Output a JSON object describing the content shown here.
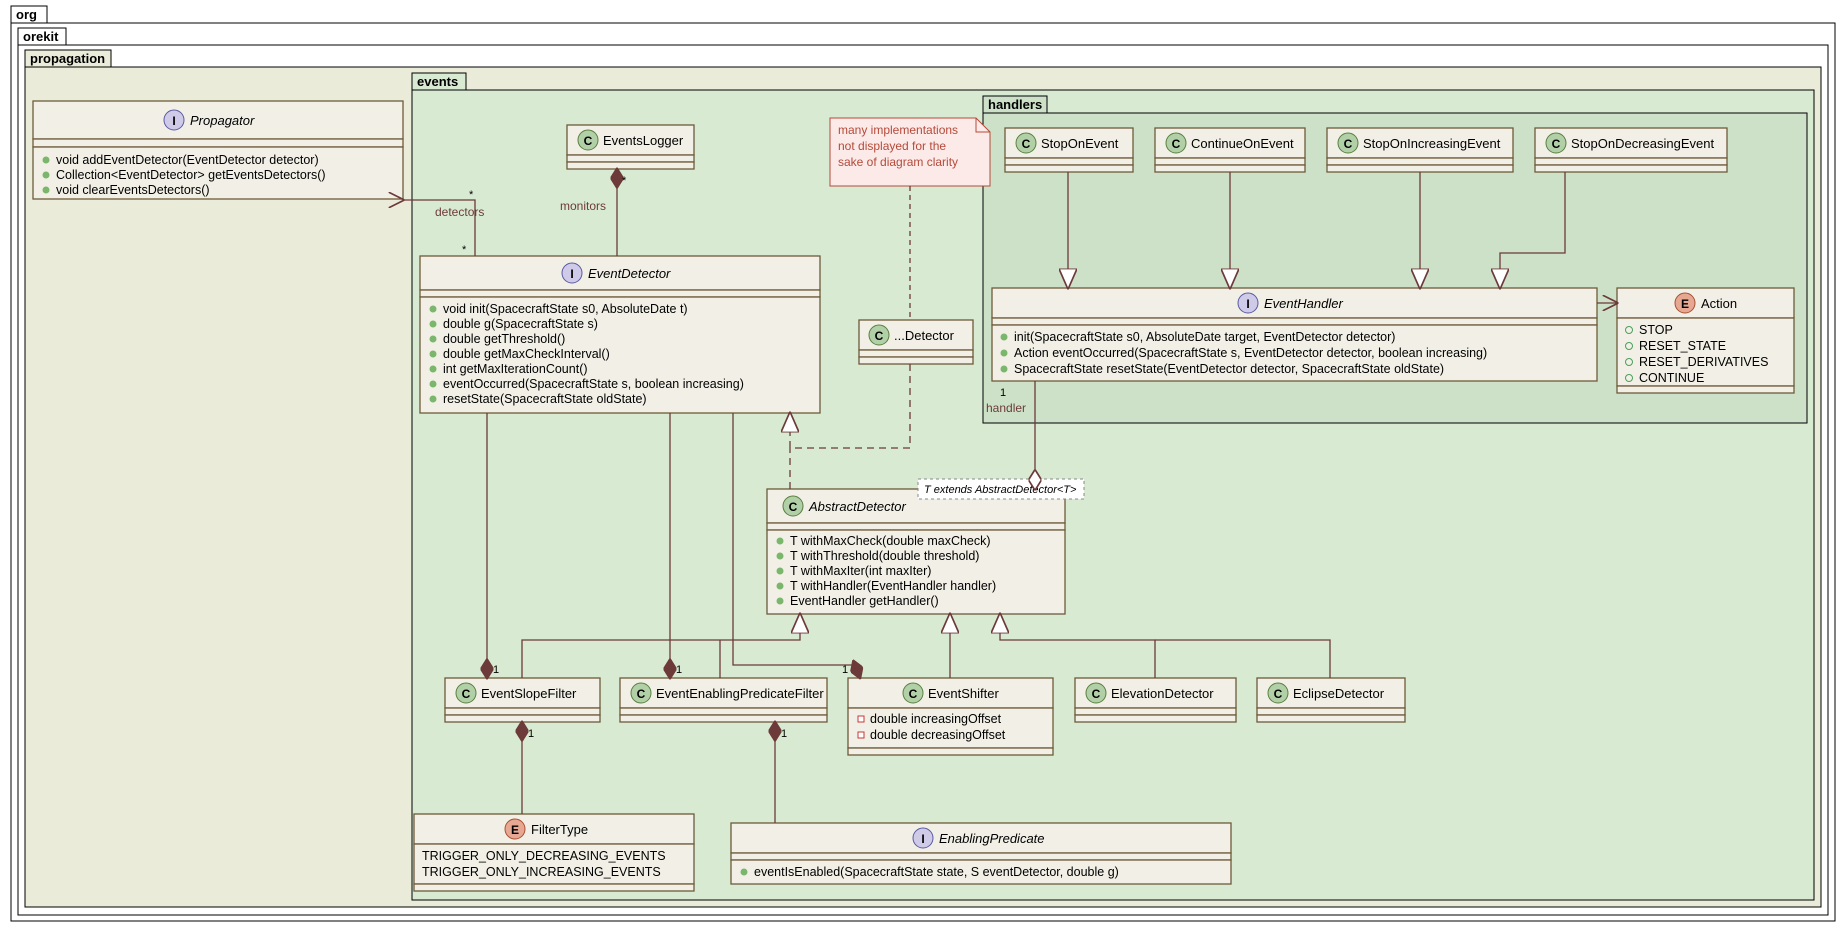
{
  "packages": {
    "root": "org",
    "p1": "orekit",
    "p2": "propagation",
    "p3": "events",
    "p4": "handlers"
  },
  "classes": {
    "Propagator": {
      "type": "I",
      "name": "Propagator",
      "members": [
        "void addEventDetector(EventDetector detector)",
        "Collection<EventDetector> getEventsDetectors()",
        "void clearEventsDetectors()"
      ]
    },
    "EventsLogger": {
      "type": "C",
      "name": "EventsLogger"
    },
    "EventDetector": {
      "type": "I",
      "name": "EventDetector",
      "members": [
        "void init(SpacecraftState s0, AbsoluteDate t)",
        "double g(SpacecraftState s)",
        "double getThreshold()",
        "double getMaxCheckInterval()",
        "int getMaxIterationCount()",
        "eventOccurred(SpacecraftState s, boolean increasing)",
        "resetState(SpacecraftState oldState)"
      ]
    },
    "ElidedDetector": {
      "type": "C",
      "name": "...Detector"
    },
    "AbstractDetector": {
      "type": "C",
      "name": "AbstractDetector",
      "tparam": "T extends AbstractDetector<T>",
      "members": [
        "T withMaxCheck(double maxCheck)",
        "T withThreshold(double threshold)",
        "T withMaxIter(int maxIter)",
        "T withHandler(EventHandler handler)",
        "EventHandler getHandler()"
      ]
    },
    "EventSlopeFilter": {
      "type": "C",
      "name": "EventSlopeFilter"
    },
    "EventEnablingPredicateFilter": {
      "type": "C",
      "name": "EventEnablingPredicateFilter"
    },
    "EventShifter": {
      "type": "C",
      "name": "EventShifter",
      "privMembers": [
        "double increasingOffset",
        "double decreasingOffset"
      ]
    },
    "ElevationDetector": {
      "type": "C",
      "name": "ElevationDetector"
    },
    "EclipseDetector": {
      "type": "C",
      "name": "EclipseDetector"
    },
    "FilterType": {
      "type": "E",
      "name": "FilterType",
      "plain": [
        "TRIGGER_ONLY_DECREASING_EVENTS",
        "TRIGGER_ONLY_INCREASING_EVENTS"
      ]
    },
    "EnablingPredicate": {
      "type": "I",
      "name": "EnablingPredicate",
      "members": [
        "eventIsEnabled(SpacecraftState state, S eventDetector, double g)"
      ]
    },
    "StopOnEvent": {
      "type": "C",
      "name": "StopOnEvent"
    },
    "ContinueOnEvent": {
      "type": "C",
      "name": "ContinueOnEvent"
    },
    "StopOnIncreasingEvent": {
      "type": "C",
      "name": "StopOnIncreasingEvent"
    },
    "StopOnDecreasingEvent": {
      "type": "C",
      "name": "StopOnDecreasingEvent"
    },
    "EventHandler": {
      "type": "I",
      "name": "EventHandler",
      "members": [
        "init(SpacecraftState s0, AbsoluteDate target, EventDetector detector)",
        "Action eventOccurred(SpacecraftState s, EventDetector detector, boolean increasing)",
        "SpacecraftState resetState(EventDetector detector, SpacecraftState oldState)"
      ]
    },
    "Action": {
      "type": "E",
      "name": "Action",
      "enumV": [
        "STOP",
        "RESET_STATE",
        "RESET_DERIVATIVES",
        "CONTINUE"
      ]
    }
  },
  "note": [
    "many implementations",
    "not displayed for the",
    "sake of diagram clarity"
  ],
  "edgeLabels": {
    "detectors": "detectors",
    "monitors": "monitors",
    "handler": "handler"
  },
  "mults": {
    "star": "*",
    "one": "1"
  }
}
